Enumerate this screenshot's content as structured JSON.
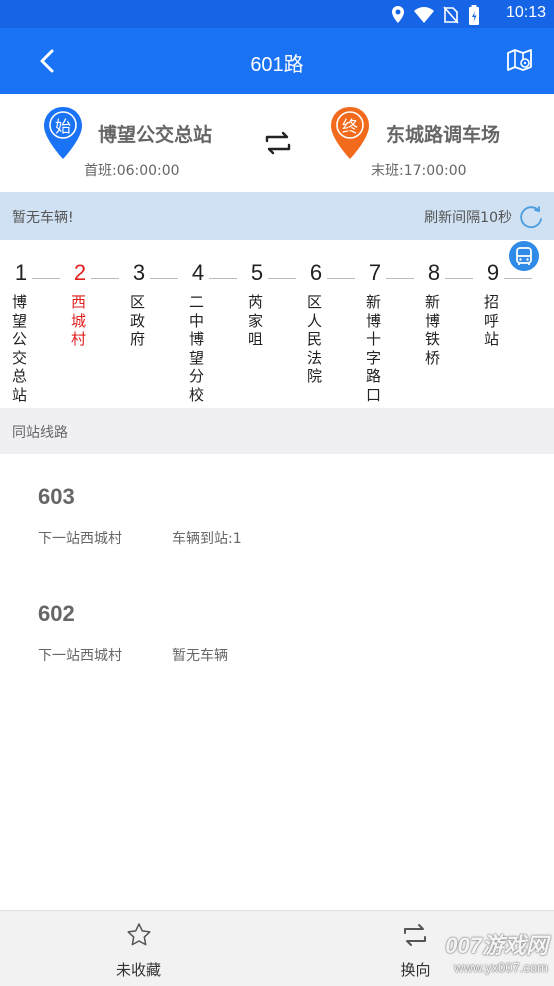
{
  "status_bar": {
    "time": "10:13",
    "icons": [
      "location-icon",
      "wifi-icon",
      "no-sim-icon",
      "battery-icon"
    ]
  },
  "app_bar": {
    "title": "601路",
    "back_icon": "back-chevron-icon",
    "map_icon": "map-icon"
  },
  "route_ends": {
    "start": {
      "badge": "始",
      "name": "博望公交总站",
      "time": "首班:06:00:00",
      "color": "#1a73f5"
    },
    "end": {
      "badge": "终",
      "name": "东城路调车场",
      "time": "末班:17:00:00",
      "color": "#f26b1d"
    }
  },
  "info_bar": {
    "no_vehicle": "暂无车辆!",
    "refresh": "刷新间隔10秒"
  },
  "stations": [
    {
      "num": "1",
      "name": "博望公交总站",
      "active": false
    },
    {
      "num": "2",
      "name": "西城村",
      "active": true
    },
    {
      "num": "3",
      "name": "区政府",
      "active": false
    },
    {
      "num": "4",
      "name": "二中博望分校",
      "active": false
    },
    {
      "num": "5",
      "name": "芮家咀",
      "active": false
    },
    {
      "num": "6",
      "name": "区人民法院",
      "active": false
    },
    {
      "num": "7",
      "name": "新博十字路口",
      "active": false
    },
    {
      "num": "8",
      "name": "新博铁桥",
      "active": false
    },
    {
      "num": "9",
      "name": "招呼站",
      "active": false
    }
  ],
  "same_station_section": {
    "title": "同站线路"
  },
  "same_routes": [
    {
      "number": "603",
      "next": "下一站西城村",
      "status": "车辆到站:1"
    },
    {
      "number": "602",
      "next": "下一站西城村",
      "status": "暂无车辆"
    }
  ],
  "bottom_bar": {
    "favorite_label": "未收藏",
    "reverse_label": "换向"
  },
  "watermark": {
    "line1": "007游戏网",
    "line2": "www.yx007.com"
  },
  "colors": {
    "primary": "#1a73f5",
    "active_station": "#e02020",
    "info_bar": "#cfe1f2"
  }
}
